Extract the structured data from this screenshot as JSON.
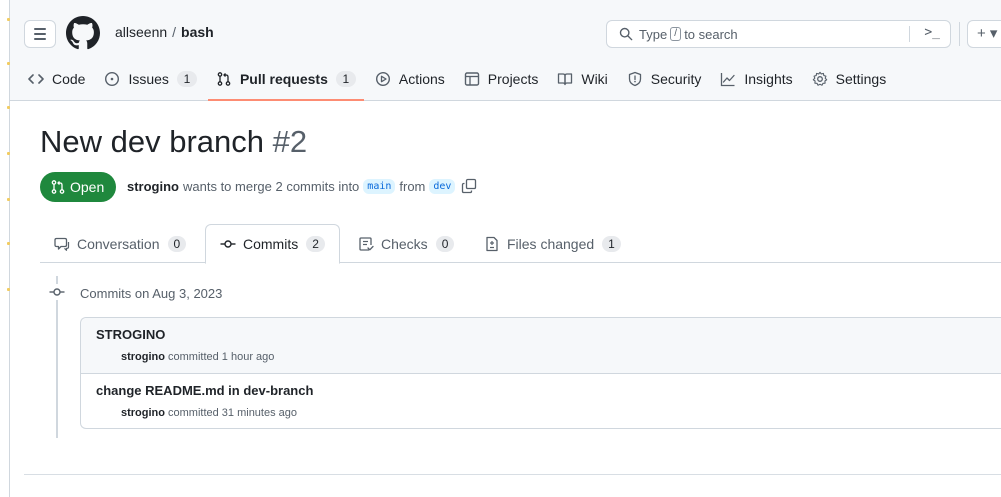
{
  "repo": {
    "owner": "allseenn",
    "separator": "/",
    "name": "bash"
  },
  "search": {
    "prefix": "Type",
    "slash_key": "/",
    "suffix": "to search",
    "command_glyph": ">_"
  },
  "header_actions": {
    "plus_label": "+ ▾"
  },
  "nav": {
    "items": [
      {
        "label": "Code",
        "icon": "code-icon"
      },
      {
        "label": "Issues",
        "icon": "issue-icon",
        "count": "1"
      },
      {
        "label": "Pull requests",
        "icon": "pull-request-icon",
        "count": "1",
        "active": true
      },
      {
        "label": "Actions",
        "icon": "play-icon"
      },
      {
        "label": "Projects",
        "icon": "table-icon"
      },
      {
        "label": "Wiki",
        "icon": "book-icon"
      },
      {
        "label": "Security",
        "icon": "shield-icon"
      },
      {
        "label": "Insights",
        "icon": "graph-icon"
      },
      {
        "label": "Settings",
        "icon": "gear-icon"
      }
    ]
  },
  "pr": {
    "title": "New dev branch",
    "number": "#2",
    "state": "Open",
    "author": "strogino",
    "merge_text": "wants to merge 2 commits into",
    "base_branch": "main",
    "from_text": "from",
    "head_branch": "dev"
  },
  "pr_tabs": [
    {
      "label": "Conversation",
      "count": "0",
      "icon": "comment-icon"
    },
    {
      "label": "Commits",
      "count": "2",
      "icon": "commit-icon",
      "active": true
    },
    {
      "label": "Checks",
      "count": "0",
      "icon": "checklist-icon"
    },
    {
      "label": "Files changed",
      "count": "1",
      "icon": "file-diff-icon"
    }
  ],
  "timeline": {
    "heading": "Commits on Aug 3, 2023",
    "commits": [
      {
        "title": "STROGINO",
        "author": "strogino",
        "action": "committed 1 hour ago"
      },
      {
        "title": "change README.md in dev-branch",
        "author": "strogino",
        "action": "committed 31 minutes ago"
      }
    ]
  },
  "colors": {
    "open_green": "#1f883d",
    "active_underline": "#fd8c73",
    "branch_blue": "#0969da",
    "branch_bg": "#ddf4ff",
    "muted_text": "#57606a",
    "border": "#d0d7de"
  }
}
